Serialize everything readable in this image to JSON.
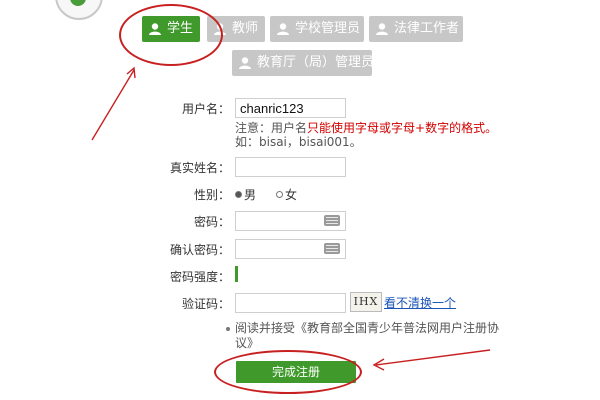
{
  "tabs": [
    {
      "label": "学生",
      "icon": "user-icon",
      "active": true
    },
    {
      "label": "教师",
      "icon": "user-icon",
      "active": false
    },
    {
      "label": "学校管理员",
      "icon": "user-icon",
      "active": false
    },
    {
      "label": "法律工作者",
      "icon": "user-icon",
      "active": false
    },
    {
      "label": "教育厅（局）管理员",
      "icon": "user-icon",
      "active": false
    }
  ],
  "form": {
    "username_label": "用户名：",
    "username_value": "chanric123",
    "username_note_prefix": "注意：用户名",
    "username_note_red": "只能使用字母或字母+数字的格式。",
    "username_example": "如：bisai，bisai001。",
    "realname_label": "真实姓名：",
    "gender_label": "性别：",
    "gender_options": [
      "男",
      "女"
    ],
    "gender_selected": "男",
    "password_label": "密码：",
    "confirm_label": "确认密码：",
    "strength_label": "密码强度：",
    "captcha_label": "验证码：",
    "captcha_image_text": "IHX",
    "captcha_refresh": "看不清换一个",
    "agreement": "阅读并接受《教育部全国青少年普法网用户注册协议》",
    "submit_label": "完成注册"
  },
  "colors": {
    "accent_green": "#3f9a2b",
    "tab_inactive": "#c7c7c7",
    "warning_red": "#d20000",
    "annotation_red": "#c82020",
    "link_blue": "#1a55b8"
  }
}
